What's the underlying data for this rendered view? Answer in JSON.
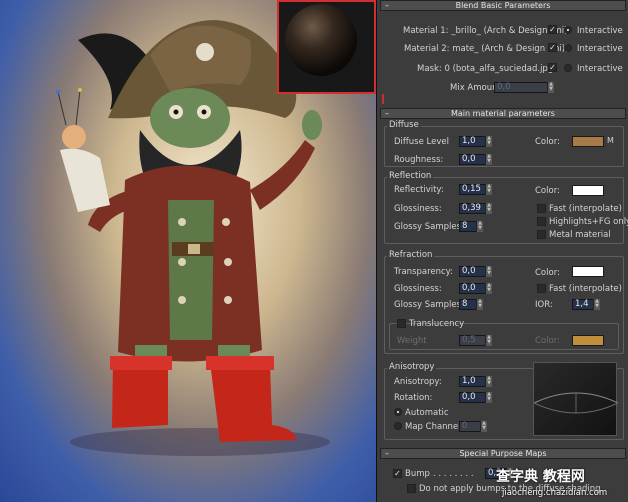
{
  "blend_basic": {
    "title": "Blend Basic Parameters",
    "material1": "Material 1: _brillo_ (Arch & Design (mi))",
    "material2": "Material 2: mate_ (Arch & Design (mi))",
    "mask": "Mask: 0 (bota_alfa_suciedad.jpg)",
    "interactive": "Interactive",
    "mix_amount_label": "Mix Amount:",
    "mix_amount": "0,0"
  },
  "main": {
    "title": "Main material parameters",
    "diffuse": {
      "title": "Diffuse",
      "level_label": "Diffuse Level",
      "level": "1,0",
      "roughness_label": "Roughness:",
      "roughness": "0,0",
      "color_label": "Color:",
      "map": "M",
      "color": "#a77b48"
    },
    "reflection": {
      "title": "Reflection",
      "reflectivity_label": "Reflectivity:",
      "reflectivity": "0,15",
      "glossiness_label": "Glossiness:",
      "glossiness": "0,39",
      "samples_label": "Glossy Samples:",
      "samples": "8",
      "color_label": "Color:",
      "color": "#ffffff",
      "fast": "Fast (interpolate)",
      "highlights": "Highlights+FG only",
      "metal": "Metal material"
    },
    "refraction": {
      "title": "Refraction",
      "transparency_label": "Transparency:",
      "transparency": "0,0",
      "glossiness_label": "Glossiness:",
      "glossiness": "0,0",
      "samples_label": "Glossy Samples:",
      "samples": "8",
      "color_label": "Color:",
      "color": "#ffffff",
      "fast": "Fast (interpolate)",
      "ior_label": "IOR:",
      "ior": "1,4",
      "translucency": "Translucency",
      "weight_label": "Weight",
      "weight": "0,5",
      "tcolor_label": "Color:",
      "tcolor": "#c08f3c"
    }
  },
  "anisotropy": {
    "title": "Anisotropy",
    "anisotropy_label": "Anisotropy:",
    "anisotropy": "1,0",
    "rotation_label": "Rotation:",
    "rotation": "0,0",
    "automatic": "Automatic",
    "map_channel": "Map Channel:",
    "map_channel_value": "0"
  },
  "special": {
    "title": "Special Purpose Maps",
    "bump": "Bump",
    "bump_dots": ". . . . . . . .",
    "bump_value": "0,3",
    "no_bump": "Do not apply bumps to the diffuse shading"
  },
  "watermark": {
    "line1": "查字典 教程网",
    "line2": "jiaocheng.chazidian.com"
  }
}
